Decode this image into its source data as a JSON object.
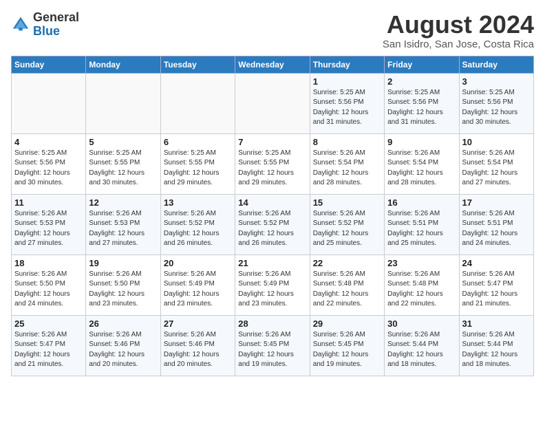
{
  "header": {
    "logo_general": "General",
    "logo_blue": "Blue",
    "month": "August 2024",
    "location": "San Isidro, San Jose, Costa Rica"
  },
  "weekdays": [
    "Sunday",
    "Monday",
    "Tuesday",
    "Wednesday",
    "Thursday",
    "Friday",
    "Saturday"
  ],
  "weeks": [
    [
      {
        "day": "",
        "detail": ""
      },
      {
        "day": "",
        "detail": ""
      },
      {
        "day": "",
        "detail": ""
      },
      {
        "day": "",
        "detail": ""
      },
      {
        "day": "1",
        "detail": "Sunrise: 5:25 AM\nSunset: 5:56 PM\nDaylight: 12 hours\nand 31 minutes."
      },
      {
        "day": "2",
        "detail": "Sunrise: 5:25 AM\nSunset: 5:56 PM\nDaylight: 12 hours\nand 31 minutes."
      },
      {
        "day": "3",
        "detail": "Sunrise: 5:25 AM\nSunset: 5:56 PM\nDaylight: 12 hours\nand 30 minutes."
      }
    ],
    [
      {
        "day": "4",
        "detail": "Sunrise: 5:25 AM\nSunset: 5:56 PM\nDaylight: 12 hours\nand 30 minutes."
      },
      {
        "day": "5",
        "detail": "Sunrise: 5:25 AM\nSunset: 5:55 PM\nDaylight: 12 hours\nand 30 minutes."
      },
      {
        "day": "6",
        "detail": "Sunrise: 5:25 AM\nSunset: 5:55 PM\nDaylight: 12 hours\nand 29 minutes."
      },
      {
        "day": "7",
        "detail": "Sunrise: 5:25 AM\nSunset: 5:55 PM\nDaylight: 12 hours\nand 29 minutes."
      },
      {
        "day": "8",
        "detail": "Sunrise: 5:26 AM\nSunset: 5:54 PM\nDaylight: 12 hours\nand 28 minutes."
      },
      {
        "day": "9",
        "detail": "Sunrise: 5:26 AM\nSunset: 5:54 PM\nDaylight: 12 hours\nand 28 minutes."
      },
      {
        "day": "10",
        "detail": "Sunrise: 5:26 AM\nSunset: 5:54 PM\nDaylight: 12 hours\nand 27 minutes."
      }
    ],
    [
      {
        "day": "11",
        "detail": "Sunrise: 5:26 AM\nSunset: 5:53 PM\nDaylight: 12 hours\nand 27 minutes."
      },
      {
        "day": "12",
        "detail": "Sunrise: 5:26 AM\nSunset: 5:53 PM\nDaylight: 12 hours\nand 27 minutes."
      },
      {
        "day": "13",
        "detail": "Sunrise: 5:26 AM\nSunset: 5:52 PM\nDaylight: 12 hours\nand 26 minutes."
      },
      {
        "day": "14",
        "detail": "Sunrise: 5:26 AM\nSunset: 5:52 PM\nDaylight: 12 hours\nand 26 minutes."
      },
      {
        "day": "15",
        "detail": "Sunrise: 5:26 AM\nSunset: 5:52 PM\nDaylight: 12 hours\nand 25 minutes."
      },
      {
        "day": "16",
        "detail": "Sunrise: 5:26 AM\nSunset: 5:51 PM\nDaylight: 12 hours\nand 25 minutes."
      },
      {
        "day": "17",
        "detail": "Sunrise: 5:26 AM\nSunset: 5:51 PM\nDaylight: 12 hours\nand 24 minutes."
      }
    ],
    [
      {
        "day": "18",
        "detail": "Sunrise: 5:26 AM\nSunset: 5:50 PM\nDaylight: 12 hours\nand 24 minutes."
      },
      {
        "day": "19",
        "detail": "Sunrise: 5:26 AM\nSunset: 5:50 PM\nDaylight: 12 hours\nand 23 minutes."
      },
      {
        "day": "20",
        "detail": "Sunrise: 5:26 AM\nSunset: 5:49 PM\nDaylight: 12 hours\nand 23 minutes."
      },
      {
        "day": "21",
        "detail": "Sunrise: 5:26 AM\nSunset: 5:49 PM\nDaylight: 12 hours\nand 23 minutes."
      },
      {
        "day": "22",
        "detail": "Sunrise: 5:26 AM\nSunset: 5:48 PM\nDaylight: 12 hours\nand 22 minutes."
      },
      {
        "day": "23",
        "detail": "Sunrise: 5:26 AM\nSunset: 5:48 PM\nDaylight: 12 hours\nand 22 minutes."
      },
      {
        "day": "24",
        "detail": "Sunrise: 5:26 AM\nSunset: 5:47 PM\nDaylight: 12 hours\nand 21 minutes."
      }
    ],
    [
      {
        "day": "25",
        "detail": "Sunrise: 5:26 AM\nSunset: 5:47 PM\nDaylight: 12 hours\nand 21 minutes."
      },
      {
        "day": "26",
        "detail": "Sunrise: 5:26 AM\nSunset: 5:46 PM\nDaylight: 12 hours\nand 20 minutes."
      },
      {
        "day": "27",
        "detail": "Sunrise: 5:26 AM\nSunset: 5:46 PM\nDaylight: 12 hours\nand 20 minutes."
      },
      {
        "day": "28",
        "detail": "Sunrise: 5:26 AM\nSunset: 5:45 PM\nDaylight: 12 hours\nand 19 minutes."
      },
      {
        "day": "29",
        "detail": "Sunrise: 5:26 AM\nSunset: 5:45 PM\nDaylight: 12 hours\nand 19 minutes."
      },
      {
        "day": "30",
        "detail": "Sunrise: 5:26 AM\nSunset: 5:44 PM\nDaylight: 12 hours\nand 18 minutes."
      },
      {
        "day": "31",
        "detail": "Sunrise: 5:26 AM\nSunset: 5:44 PM\nDaylight: 12 hours\nand 18 minutes."
      }
    ]
  ]
}
